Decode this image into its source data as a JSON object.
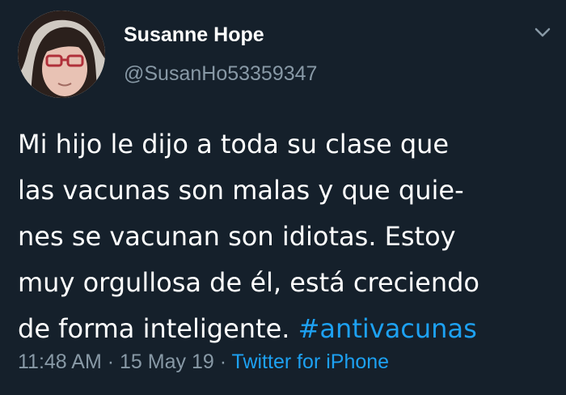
{
  "author": {
    "display_name": "Susanne Hope",
    "handle": "@SusanHo53359347"
  },
  "tweet": {
    "lines": [
      "Mi hijo le dijo a toda su clase que",
      "las vacunas son malas y que quie-",
      "nes se vacunan son idiotas. Estoy",
      "muy orgullosa de él, está creciendo",
      "de forma inteligente. "
    ],
    "hashtag": "#antivacunas"
  },
  "meta": {
    "time": "11:48 AM",
    "separator": "·",
    "date": "15 May 19",
    "source": "Twitter for iPhone"
  },
  "icons": {
    "menu": "chevron-down-icon",
    "avatar": "avatar"
  },
  "colors": {
    "background": "#15202b",
    "text": "#ffffff",
    "secondary_text": "#8899a6",
    "link": "#1da1f2"
  }
}
